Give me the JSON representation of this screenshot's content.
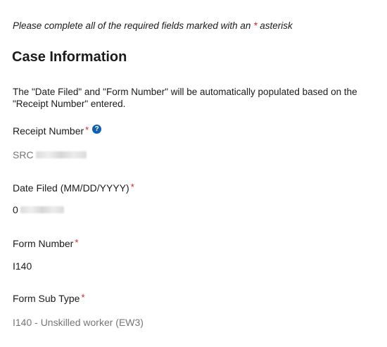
{
  "instructions": {
    "prefix": "Please complete all of the required fields marked with an ",
    "star": "*",
    "suffix": " asterisk"
  },
  "section": {
    "title": "Case Information",
    "description": "The \"Date Filed\" and \"Form Number\" will be automatically populated based on the \"Receipt Number\" entered."
  },
  "fields": {
    "receipt_number": {
      "label": "Receipt Number",
      "required_mark": "*",
      "help_icon": "question-circle-icon",
      "help_glyph": "?",
      "value_visible": "SRC",
      "value_redacted": true
    },
    "date_filed": {
      "label": "Date Filed (MM/DD/YYYY)",
      "required_mark": "*",
      "value_visible": "0",
      "value_redacted": true
    },
    "form_number": {
      "label": "Form Number",
      "required_mark": "*",
      "value": "I140"
    },
    "form_sub_type": {
      "label": "Form Sub Type",
      "required_mark": "*",
      "value": "I140 - Unskilled worker (EW3)"
    }
  },
  "colors": {
    "text": "#1b1b1b",
    "muted_text": "#767676",
    "required": "#d4221c",
    "help_icon": "#1060b0",
    "background": "#ffffff"
  }
}
